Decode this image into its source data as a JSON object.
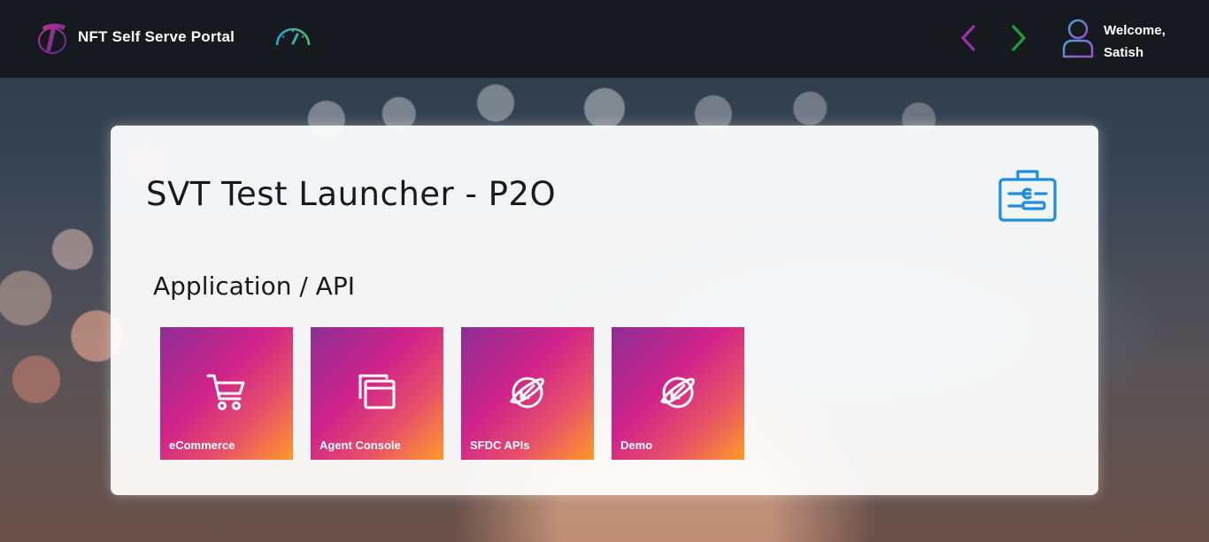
{
  "header": {
    "app_title": "NFT Self Serve Portal",
    "welcome_line1": "Welcome,",
    "welcome_line2": "Satish",
    "icons": {
      "logo": "telstra-logo",
      "dashboard": "speedometer-icon",
      "back": "chevron-left-icon",
      "forward": "chevron-right-icon",
      "user": "user-avatar-icon"
    },
    "colors": {
      "back_arrow": "#9b2fae",
      "forward_arrow": "#1f9d3a"
    }
  },
  "main": {
    "title": "SVT Test Launcher - P2O",
    "section_title": "Application / API",
    "header_icon": "toolbox-icon",
    "accent_color": "#1a8fe0",
    "tiles": [
      {
        "label": "eCommerce",
        "icon": "shopping-cart-icon"
      },
      {
        "label": "Agent Console",
        "icon": "windows-icon"
      },
      {
        "label": "SFDC APIs",
        "icon": "globe-arrow-icon"
      },
      {
        "label": "Demo",
        "icon": "globe-arrow-icon"
      }
    ]
  }
}
